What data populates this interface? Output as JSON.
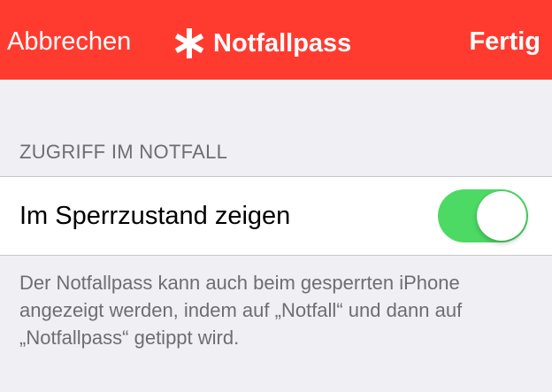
{
  "nav": {
    "cancel_label": "Abbrechen",
    "title": "Notfallpass",
    "title_icon": "asterisk-icon",
    "done_label": "Fertig"
  },
  "section": {
    "header": "ZUGRIFF IM NOTFALL",
    "cell_label": "Im Sperrzustand zeigen",
    "toggle_on": true,
    "footer": "Der Notfallpass kann auch beim gesperrten iPhone angezeigt werden, indem auf „Notfall“ und dann auf „Notfallpass“ getippt wird."
  },
  "colors": {
    "accent_red": "#ff3b30",
    "toggle_green": "#4cd964",
    "background": "#efeff4"
  }
}
